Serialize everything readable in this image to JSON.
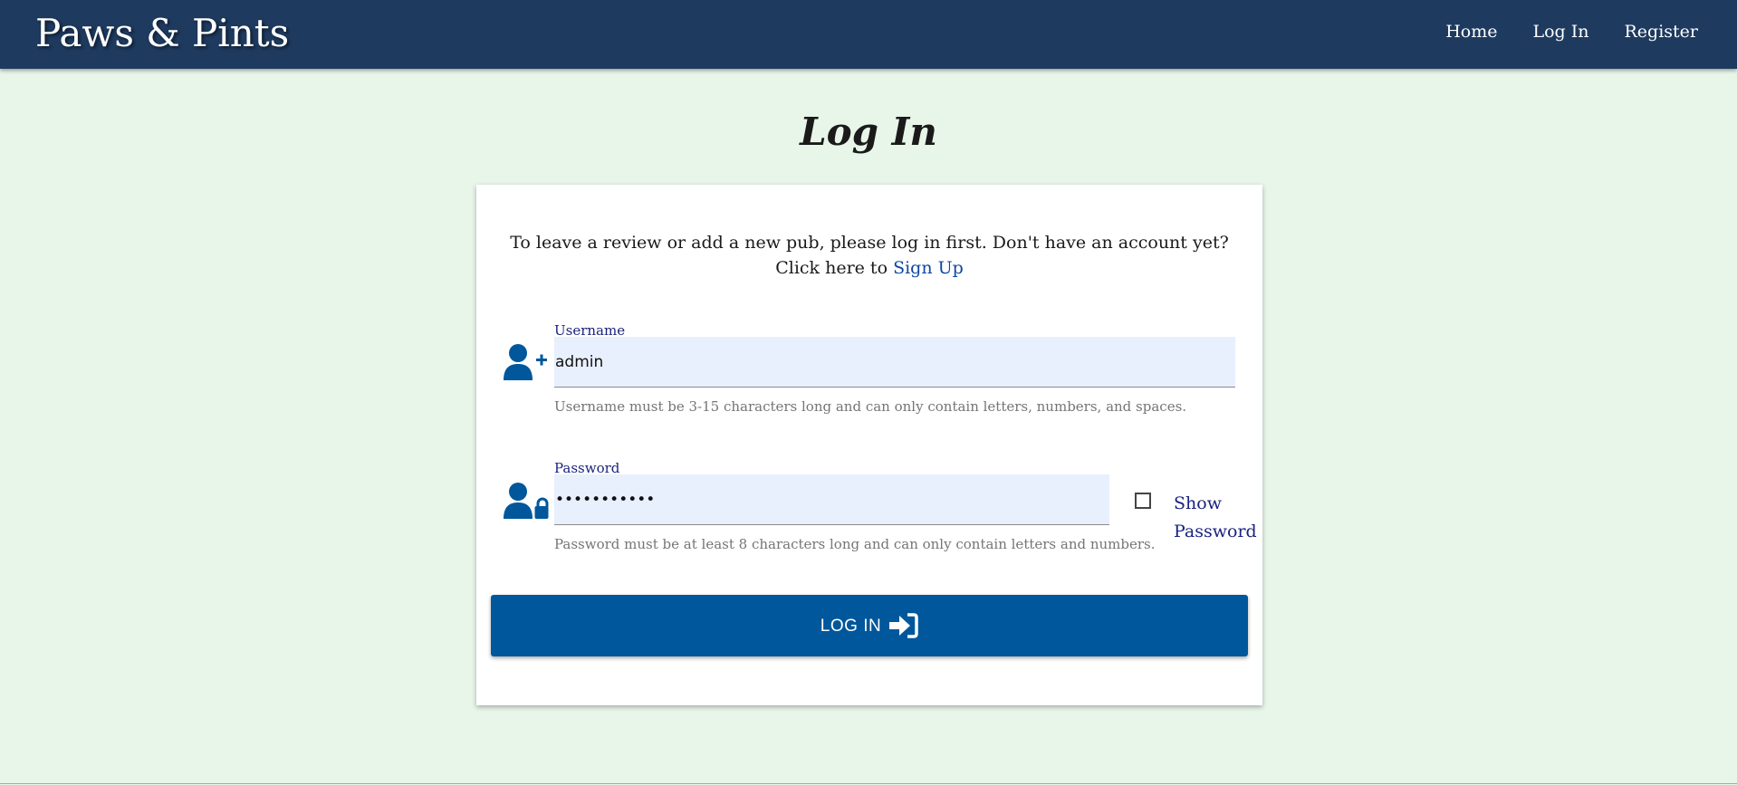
{
  "navbar": {
    "brand": "Paws & Pints",
    "links": [
      "Home",
      "Log In",
      "Register"
    ]
  },
  "page": {
    "title": "Log In"
  },
  "card": {
    "intro_text": "To leave a review or add a new pub, please log in first. Don't have an account yet? Click here to ",
    "signup_link": "Sign Up",
    "username": {
      "label": "Username",
      "value": "admin",
      "helper": "Username must be 3-15 characters long and can only contain letters, numbers, and spaces."
    },
    "password": {
      "label": "Password",
      "value": "admin123456",
      "helper": "Password must be at least 8 characters long and can only contain letters and numbers.",
      "show_label": "Show Password",
      "show_checked": false
    },
    "login_button": "LOG IN"
  },
  "colors": {
    "navbar": "#1e3a5f",
    "background": "#e8f5e9",
    "button": "#01579b",
    "icon": "#01579b",
    "input_bg": "#e8f0fe"
  },
  "icons": [
    "user-plus-icon",
    "user-lock-icon",
    "sign-in-icon"
  ]
}
